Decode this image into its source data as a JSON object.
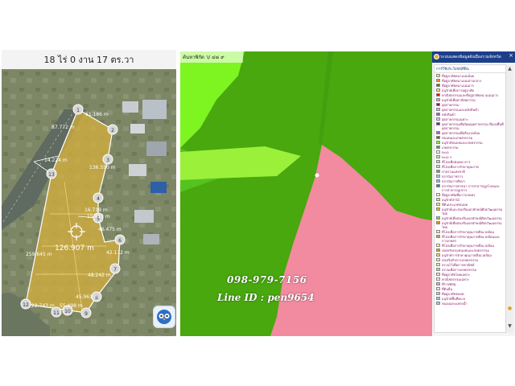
{
  "left_panel": {
    "area_title": "18  ไร่ 0   งาน 17   ตร.วา",
    "center_measure": "126.907 m",
    "vertices": [
      "1",
      "2",
      "3",
      "4",
      "5",
      "6",
      "7",
      "8",
      "9",
      "10",
      "11",
      "12",
      "13"
    ],
    "side_lengths": [
      "61.186 m",
      "87.772 m",
      "136.550 m",
      "14.224 m",
      "15.413 m",
      "16.719 m",
      "46.475 m",
      "42.172 m",
      "48.242 m",
      "45.961 m",
      "259.645 m",
      "22.743 m",
      "55.498 m"
    ]
  },
  "right_panel": {
    "search_label": "ค้นหาพิกัด  ว/ ๔๘ ๙",
    "phone_overlay": "098-979-7156",
    "lineid_overlay": "Line ID : pen9654",
    "legend": {
      "title": "ระบบแสดงข้อมูลผังเมืองรวมจังหวัด",
      "close_label": "×",
      "section_title": "การใช้ประโยชน์ที่ดิน",
      "items": [
        {
          "color": "#ffff00",
          "label": "ที่อยู่อาศัยหนาแน่นน้อย"
        },
        {
          "color": "#f7941d",
          "label": "ที่อยู่อาศัยหนาแน่นปานกลาง"
        },
        {
          "color": "#a0522d",
          "label": "ที่อยู่อาศัยหนาแน่นมาก"
        },
        {
          "color": "#ffd580",
          "label": "อนุรักษ์เพื่อการอยู่อาศัย"
        },
        {
          "color": "#ff0000",
          "label": "พาณิชยกรรมและที่อยู่อาศัยหนาแน่นมาก"
        },
        {
          "color": "#ff9999",
          "label": "อนุรักษ์เพื่อพาณิชยกรรม"
        },
        {
          "color": "#800080",
          "label": "อุตสาหกรรม"
        },
        {
          "color": "#e5a0e5",
          "label": "อุตสาหกรรมและคลังสินค้า"
        },
        {
          "color": "#9b59b6",
          "label": "คลังสินค้า"
        },
        {
          "color": "#dfc8ec",
          "label": "อุตสาหกรรมเฉพาะ"
        },
        {
          "color": "#6b1fa0",
          "label": "อุตสาหกรรมเพื่อนิคมอุตสาหกรรม ที่แบ่งพื้นที่อุตสาหกรรม"
        },
        {
          "color": "#c94fc9",
          "label": "อุตสาหกรรมเพื่อสิ่งแวดล้อม"
        },
        {
          "color": "#228b22",
          "label": "ชนบทและเกษตรกรรม"
        },
        {
          "color": "#7cfc00",
          "label": "อนุรักษ์ชนบทและเกษตรกรรม"
        },
        {
          "color": "#55a630",
          "label": "เกษตรกรรม"
        },
        {
          "color": "#f5f5f5",
          "label": "ทะเล"
        },
        {
          "color": "#b8e6b8",
          "label": "ทะเล ฯ"
        },
        {
          "color": "#a6e3e3",
          "label": "ที่โล่งเพื่อนันทนาการ"
        },
        {
          "color": "#c8e6a0",
          "label": "ที่โล่งเพื่อการรักษาคุณภาพ"
        },
        {
          "color": "#5fa0c8",
          "label": "ป่าสงวนแห่งชาติ"
        },
        {
          "color": "#a8c8f0",
          "label": "สถาบันราชการ"
        },
        {
          "color": "#74b9ff",
          "label": "สถาบันการศึกษา"
        },
        {
          "color": "#1f75c9",
          "label": "สถาบันการศาสนา การสาธารณูปโภคและการสาธารณูปการ"
        },
        {
          "color": "#ffffcc",
          "label": "ที่อยู่อาศัยเพื่อการเกษตร"
        },
        {
          "color": "#c4e17f",
          "label": "อนุรักษ์ป่าไม้"
        },
        {
          "color": "#e8e86a",
          "label": "ที่ดินประเภทชนบท"
        },
        {
          "color": "#e6c200",
          "label": "อนุรักษ์และส่งเสริมเอกลักษณ์ศิลปวัฒนธรรมไทย"
        },
        {
          "color": "#9acd32",
          "label": "อนุรักษ์เพื่อส่งเสริมเอกลักษณ์ศิลปวัฒนธรรม"
        },
        {
          "color": "#ff8c00",
          "label": "อนุรักษ์เพื่อส่งเสริมเอกลักษณ์ศิลปวัฒนธรรมไทย"
        },
        {
          "color": "#ffeb99",
          "label": "ที่โล่งเพื่อการรักษาคุณภาพสิ่งแวดล้อม"
        },
        {
          "color": "#c2a36b",
          "label": "ที่โล่งเพื่อการรักษาคุณภาพสิ่งแวดล้อมและการเกษตร"
        },
        {
          "color": "#ffff99",
          "label": "ที่โล่งเพื่อการรักษาคุณภาพสิ่งแวดล้อม"
        },
        {
          "color": "#d4a017",
          "label": "เขตปรับปรุงชนบทและเกษตรกรรม"
        },
        {
          "color": "#ffcc66",
          "label": "อนุรักษ์การรักษาคุณภาพสิ่งแวดล้อม"
        },
        {
          "color": "#ffe4b5",
          "label": "ส่งเสริมกิจการเกษตรกรรม"
        },
        {
          "color": "#f0e68c",
          "label": "สงวนไว้เพื่อการพาณิชย์"
        },
        {
          "color": "#90ee90",
          "label": "สงวนเพื่อการเกษตรกรรม"
        },
        {
          "color": "#ffdab9",
          "label": "ที่อยู่อาศัยโดยเฉพาะ"
        },
        {
          "color": "#ffe4e1",
          "label": "พาณิชยกรรมเฉพาะ"
        },
        {
          "color": "#dda0dd",
          "label": "ที่ราชพัสดุ"
        },
        {
          "color": "#e6e6fa",
          "label": "ที่ดินอื่น"
        },
        {
          "color": "#ffb6c1",
          "label": "ที่อยู่อาศัยชนบท"
        },
        {
          "color": "#87cefa",
          "label": "อนุรักษ์พื้นที่ทะเล"
        },
        {
          "color": "#b0c4de",
          "label": "หนองและแหล่งน้ำ"
        }
      ]
    }
  }
}
